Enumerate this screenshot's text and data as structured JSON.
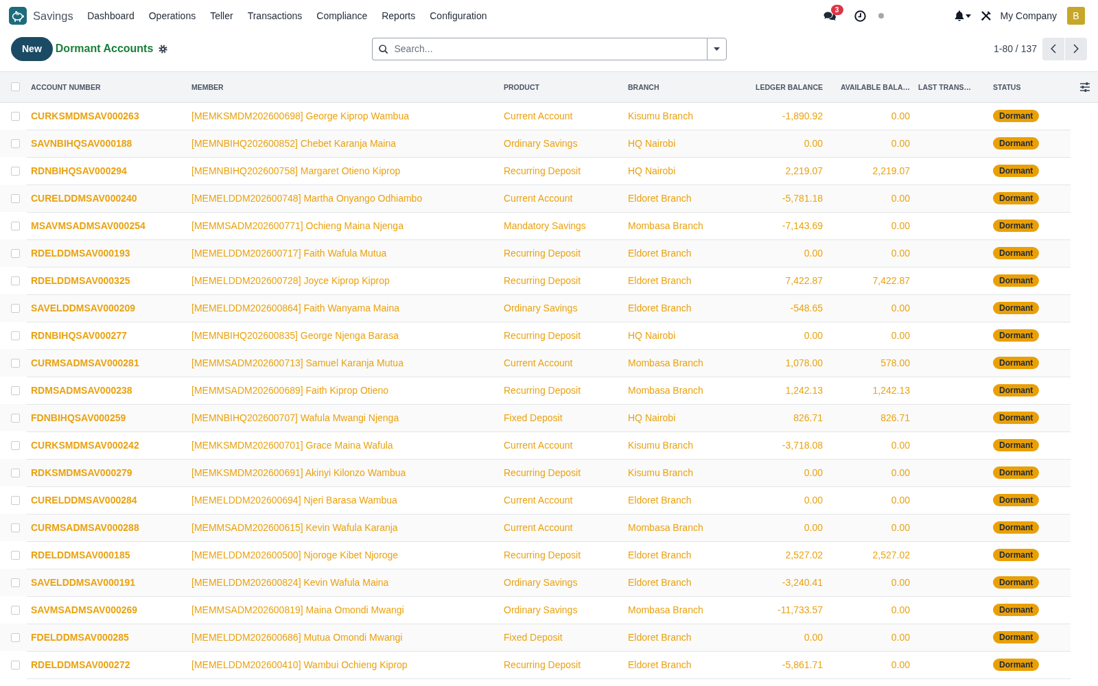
{
  "navbar": {
    "app_name": "Savings",
    "menu": [
      "Dashboard",
      "Operations",
      "Teller",
      "Transactions",
      "Compliance",
      "Reports",
      "Configuration"
    ],
    "message_count": "3",
    "company": "My Company",
    "avatar_letter": "B"
  },
  "control_panel": {
    "new_button": "New",
    "title": "Dormant Accounts",
    "search": {
      "placeholder": "Search..."
    },
    "pager": "1-80 / 137"
  },
  "table": {
    "select_all_checked": false,
    "columns": [
      {
        "label": "ACCOUNT NUMBER",
        "kind": "code"
      },
      {
        "label": "MEMBER",
        "kind": "text"
      },
      {
        "label": "PRODUCT",
        "kind": "text"
      },
      {
        "label": "BRANCH",
        "kind": "text"
      },
      {
        "label": "LEDGER BALANCE",
        "kind": "amount"
      },
      {
        "label": "AVAILABLE BALA…",
        "kind": "amount"
      },
      {
        "label": "LAST TRANS…",
        "kind": "date"
      },
      {
        "label": "STATUS",
        "kind": "badge"
      }
    ],
    "rows": [
      {
        "checked": false,
        "account_number": "CURKSMDMSAV000263",
        "member": "[MEMKSMDM202600698] George Kiprop Wambua",
        "product": "Current Account",
        "branch": "Kisumu Branch",
        "ledger_balance": "-1,890.92",
        "available_balance": "0.00",
        "status": "Dormant"
      },
      {
        "checked": false,
        "account_number": "SAVNBIHQSAV000188",
        "member": "[MEMNBIHQ202600852] Chebet Karanja Maina",
        "product": "Ordinary Savings",
        "branch": "HQ Nairobi",
        "ledger_balance": "0.00",
        "available_balance": "0.00",
        "status": "Dormant"
      },
      {
        "checked": false,
        "account_number": "RDNBIHQSAV000294",
        "member": "[MEMNBIHQ202600758] Margaret Otieno Kiprop",
        "product": "Recurring Deposit",
        "branch": "HQ Nairobi",
        "ledger_balance": "2,219.07",
        "available_balance": "2,219.07",
        "status": "Dormant"
      },
      {
        "checked": false,
        "account_number": "CURELDDMSAV000240",
        "member": "[MEMELDDM202600748] Martha Onyango Odhiambo",
        "product": "Current Account",
        "branch": "Eldoret Branch",
        "ledger_balance": "-5,781.18",
        "available_balance": "0.00",
        "status": "Dormant"
      },
      {
        "checked": false,
        "account_number": "MSAVMSADMSAV000254",
        "member": "[MEMMSADM202600771] Ochieng Maina Njenga",
        "product": "Mandatory Savings",
        "branch": "Mombasa Branch",
        "ledger_balance": "-7,143.69",
        "available_balance": "0.00",
        "status": "Dormant"
      },
      {
        "checked": false,
        "account_number": "RDELDDMSAV000193",
        "member": "[MEMELDDM202600717] Faith Wafula Mutua",
        "product": "Recurring Deposit",
        "branch": "Eldoret Branch",
        "ledger_balance": "0.00",
        "available_balance": "0.00",
        "status": "Dormant"
      },
      {
        "checked": false,
        "account_number": "RDELDDMSAV000325",
        "member": "[MEMELDDM202600728] Joyce Kiprop Kiprop",
        "product": "Recurring Deposit",
        "branch": "Eldoret Branch",
        "ledger_balance": "7,422.87",
        "available_balance": "7,422.87",
        "status": "Dormant"
      },
      {
        "checked": false,
        "account_number": "SAVELDDMSAV000209",
        "member": "[MEMELDDM202600864] Faith Wanyama Maina",
        "product": "Ordinary Savings",
        "branch": "Eldoret Branch",
        "ledger_balance": "-548.65",
        "available_balance": "0.00",
        "status": "Dormant"
      },
      {
        "checked": false,
        "account_number": "RDNBIHQSAV000277",
        "member": "[MEMNBIHQ202600835] George Njenga Barasa",
        "product": "Recurring Deposit",
        "branch": "HQ Nairobi",
        "ledger_balance": "0.00",
        "available_balance": "0.00",
        "status": "Dormant"
      },
      {
        "checked": false,
        "account_number": "CURMSADMSAV000281",
        "member": "[MEMMSADM202600713] Samuel Karanja Mutua",
        "product": "Current Account",
        "branch": "Mombasa Branch",
        "ledger_balance": "1,078.00",
        "available_balance": "578.00",
        "status": "Dormant"
      },
      {
        "checked": false,
        "account_number": "RDMSADMSAV000238",
        "member": "[MEMMSADM202600689] Faith Kiprop Otieno",
        "product": "Recurring Deposit",
        "branch": "Mombasa Branch",
        "ledger_balance": "1,242.13",
        "available_balance": "1,242.13",
        "status": "Dormant"
      },
      {
        "checked": false,
        "account_number": "FDNBIHQSAV000259",
        "member": "[MEMNBIHQ202600707] Wafula Mwangi Njenga",
        "product": "Fixed Deposit",
        "branch": "HQ Nairobi",
        "ledger_balance": "826.71",
        "available_balance": "826.71",
        "status": "Dormant"
      },
      {
        "checked": false,
        "account_number": "CURKSMDMSAV000242",
        "member": "[MEMKSMDM202600701] Grace Maina Wafula",
        "product": "Current Account",
        "branch": "Kisumu Branch",
        "ledger_balance": "-3,718.08",
        "available_balance": "0.00",
        "status": "Dormant"
      },
      {
        "checked": false,
        "account_number": "RDKSMDMSAV000279",
        "member": "[MEMKSMDM202600691] Akinyi Kilonzo Wambua",
        "product": "Recurring Deposit",
        "branch": "Kisumu Branch",
        "ledger_balance": "0.00",
        "available_balance": "0.00",
        "status": "Dormant"
      },
      {
        "checked": false,
        "account_number": "CURELDDMSAV000284",
        "member": "[MEMELDDM202600694] Njeri Barasa Wambua",
        "product": "Current Account",
        "branch": "Eldoret Branch",
        "ledger_balance": "0.00",
        "available_balance": "0.00",
        "status": "Dormant"
      },
      {
        "checked": false,
        "account_number": "CURMSADMSAV000288",
        "member": "[MEMMSADM202600615] Kevin Wafula Karanja",
        "product": "Current Account",
        "branch": "Mombasa Branch",
        "ledger_balance": "0.00",
        "available_balance": "0.00",
        "status": "Dormant"
      },
      {
        "checked": false,
        "account_number": "RDELDDMSAV000185",
        "member": "[MEMELDDM202600500] Njoroge Kibet Njoroge",
        "product": "Recurring Deposit",
        "branch": "Eldoret Branch",
        "ledger_balance": "2,527.02",
        "available_balance": "2,527.02",
        "status": "Dormant"
      },
      {
        "checked": false,
        "account_number": "SAVELDDMSAV000191",
        "member": "[MEMELDDM202600824] Kevin Wafula Maina",
        "product": "Ordinary Savings",
        "branch": "Eldoret Branch",
        "ledger_balance": "-3,240.41",
        "available_balance": "0.00",
        "status": "Dormant"
      },
      {
        "checked": false,
        "account_number": "SAVMSADMSAV000269",
        "member": "[MEMMSADM202600819] Maina Omondi Mwangi",
        "product": "Ordinary Savings",
        "branch": "Mombasa Branch",
        "ledger_balance": "-11,733.57",
        "available_balance": "0.00",
        "status": "Dormant"
      },
      {
        "checked": false,
        "account_number": "FDELDDMSAV000285",
        "member": "[MEMELDDM202600686] Mutua Omondi Mwangi",
        "product": "Fixed Deposit",
        "branch": "Eldoret Branch",
        "ledger_balance": "0.00",
        "available_balance": "0.00",
        "status": "Dormant"
      },
      {
        "checked": false,
        "account_number": "RDELDDMSAV000272",
        "member": "[MEMELDDM202600410] Wambui Ochieng Kiprop",
        "product": "Recurring Deposit",
        "branch": "Eldoret Branch",
        "ledger_balance": "-5,861.71",
        "available_balance": "0.00",
        "status": "Dormant"
      }
    ]
  }
}
